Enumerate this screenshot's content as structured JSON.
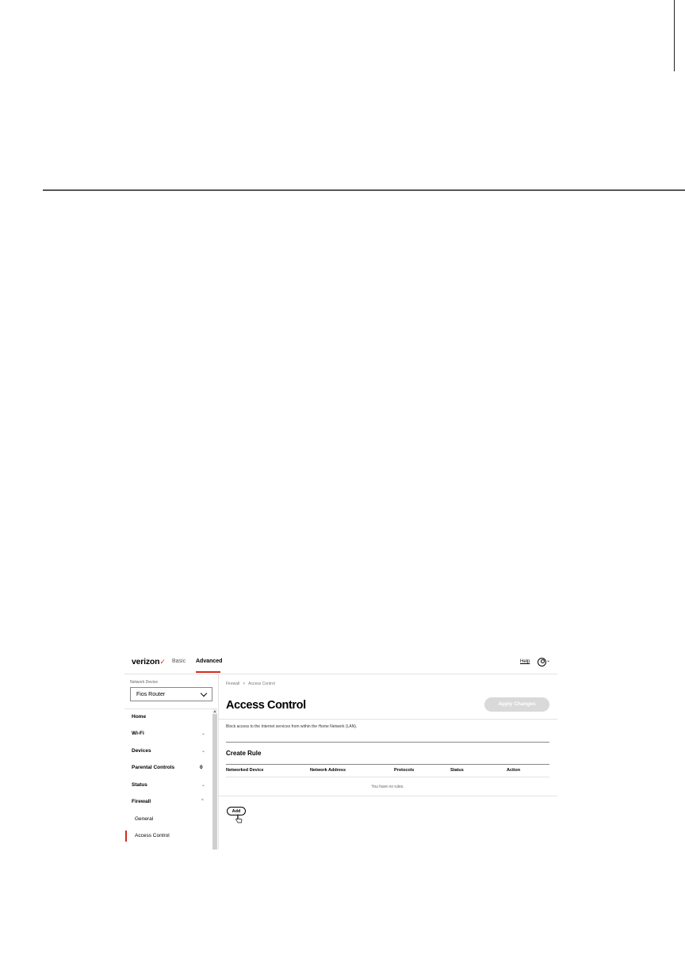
{
  "app": {
    "brand": "verizon",
    "nav": {
      "basic": "Basic",
      "advanced": "Advanced"
    },
    "help": "Help",
    "accent": "#d52b1e"
  },
  "sidebar": {
    "network_device_label": "Network Device",
    "network_device_value": "Fios Router",
    "items": [
      {
        "label": "Home"
      },
      {
        "label": "Wi-Fi",
        "chevron": "⌄"
      },
      {
        "label": "Devices",
        "chevron": "⌄"
      },
      {
        "label": "Parental Controls",
        "count": "0"
      },
      {
        "label": "Status",
        "chevron": "⌄"
      },
      {
        "label": "Firewall",
        "chevron": "^"
      }
    ],
    "sub_items": [
      {
        "label": "General"
      },
      {
        "label": "Access Control"
      }
    ]
  },
  "main": {
    "breadcrumb": [
      "Firewall",
      "Access Control"
    ],
    "breadcrumb_sep": ">",
    "title": "Access Control",
    "apply_label": "Apply Changes",
    "description": "Block access to the Internet services from within the Home Network (LAN).",
    "section_title": "Create Rule",
    "columns": [
      "Networked Device",
      "Network Address",
      "Protocols",
      "Status",
      "Action"
    ],
    "empty_text": "You have no rules.",
    "add_label": "Add"
  }
}
